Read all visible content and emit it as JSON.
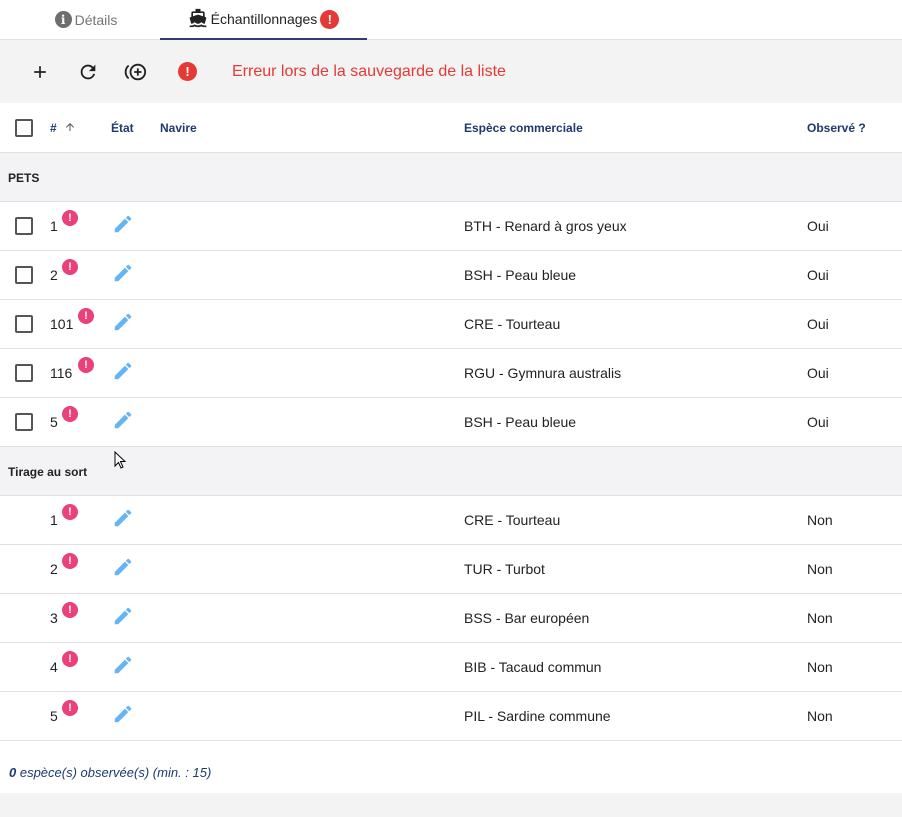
{
  "tabs": [
    {
      "label": "Détails",
      "icon": "info-icon"
    },
    {
      "label": "Échantillonnages",
      "icon": "ship-icon",
      "active": true,
      "has_error": true
    }
  ],
  "toolbar": {
    "error_message": "Erreur lors de la sauvegarde de la liste",
    "buttons": [
      "add-icon",
      "refresh-icon",
      "add-circle-icon"
    ]
  },
  "table": {
    "headers": {
      "number": "#",
      "state": "État",
      "vessel": "Navire",
      "species": "Espèce commerciale",
      "observed": "Observé ?"
    },
    "sort": {
      "column": "number",
      "direction": "ascending"
    },
    "groups": [
      {
        "label": "PETS",
        "selectable": true,
        "rows": [
          {
            "number": "1",
            "species": "BTH - Renard à gros yeux",
            "observed": "Oui"
          },
          {
            "number": "2",
            "species": "BSH - Peau bleue",
            "observed": "Oui"
          },
          {
            "number": "101",
            "species": "CRE - Tourteau",
            "observed": "Oui"
          },
          {
            "number": "116",
            "species": "RGU - Gymnura australis",
            "observed": "Oui"
          },
          {
            "number": "5",
            "species": "BSH - Peau bleue",
            "observed": "Oui"
          }
        ]
      },
      {
        "label": "Tirage au sort",
        "selectable": false,
        "rows": [
          {
            "number": "1",
            "species": "CRE - Tourteau",
            "observed": "Non"
          },
          {
            "number": "2",
            "species": "TUR - Turbot",
            "observed": "Non"
          },
          {
            "number": "3",
            "species": "BSS - Bar européen",
            "observed": "Non"
          },
          {
            "number": "4",
            "species": "BIB - Tacaud commun",
            "observed": "Non"
          },
          {
            "number": "5",
            "species": "PIL - Sardine commune",
            "observed": "Non"
          }
        ]
      }
    ],
    "footer": {
      "count": "0",
      "text": " espèce(s) observée(s) (min. : 15)"
    }
  },
  "colors": {
    "accent": "#1e3a6e",
    "error": "#e53935",
    "row_badge": "#ec407a",
    "edit": "#64b5f6"
  }
}
